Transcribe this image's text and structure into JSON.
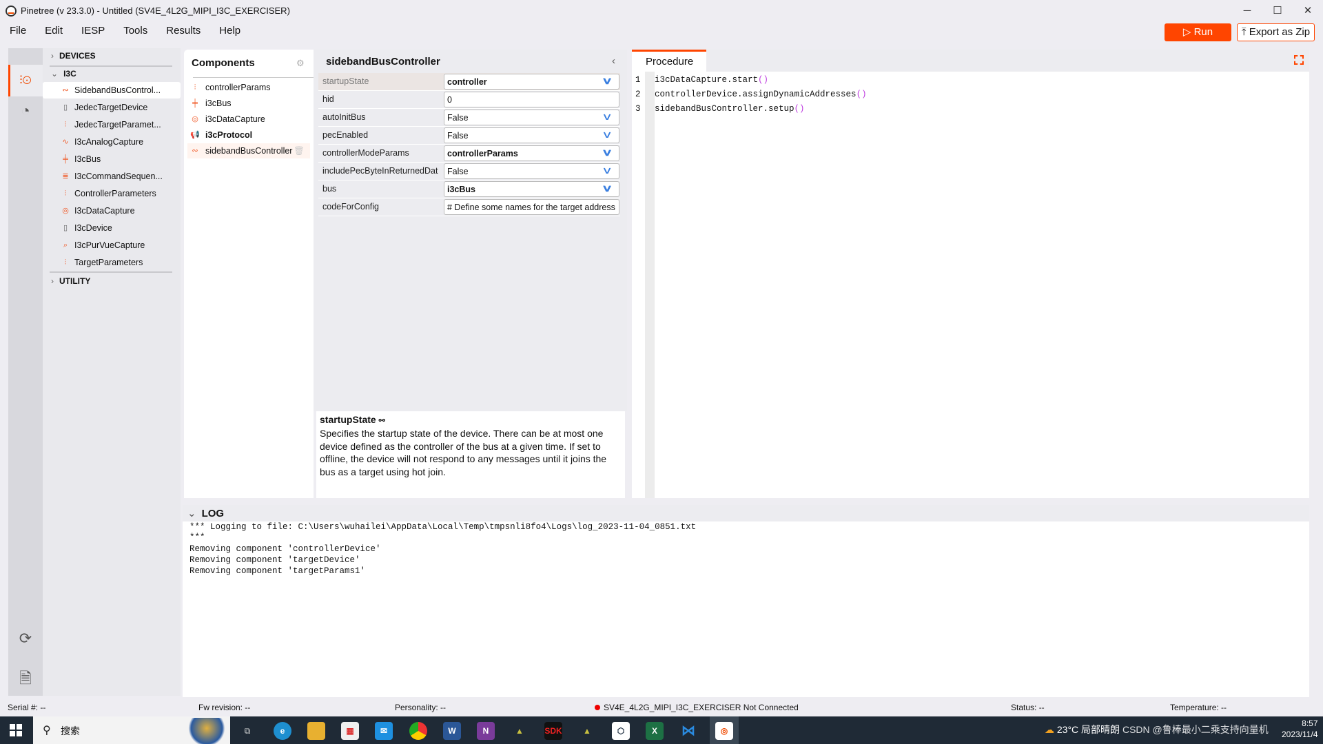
{
  "window": {
    "title": "Pinetree (v 23.3.0) - Untitled (SV4E_4L2G_MIPI_I3C_EXERCISER)",
    "minimize": "─",
    "maximize": "☐",
    "close": "✕"
  },
  "menu": [
    "File",
    "Edit",
    "IESP",
    "Tools",
    "Results",
    "Help"
  ],
  "toolbar": {
    "run_label": "▷ Run",
    "export_label": "⤒ Export as Zip",
    "accent": "#ff4500"
  },
  "tree": {
    "devices": "DEVICES",
    "i3c": "I3C",
    "utility": "UTILITY",
    "items": [
      {
        "label": "SidebandBusControl...",
        "icon": "sideband-icon"
      },
      {
        "label": "JedecTargetDevice",
        "icon": "device-icon"
      },
      {
        "label": "JedecTargetParamet...",
        "icon": "sliders-icon"
      },
      {
        "label": "I3cAnalogCapture",
        "icon": "analog-icon"
      },
      {
        "label": "I3cBus",
        "icon": "bus-icon"
      },
      {
        "label": "I3cCommandSequen...",
        "icon": "sequence-icon"
      },
      {
        "label": "ControllerParameters",
        "icon": "sliders-icon"
      },
      {
        "label": "I3cDataCapture",
        "icon": "capture-icon"
      },
      {
        "label": "I3cDevice",
        "icon": "device-icon"
      },
      {
        "label": "I3cPurVueCapture",
        "icon": "purvue-icon"
      },
      {
        "label": "TargetParameters",
        "icon": "sliders-icon"
      }
    ]
  },
  "components": {
    "title": "Components",
    "items": [
      {
        "label": "controllerParams"
      },
      {
        "label": "i3cBus"
      },
      {
        "label": "i3cDataCapture"
      },
      {
        "label": "i3cProtocol"
      },
      {
        "label": "sidebandBusController"
      }
    ]
  },
  "properties": {
    "title": "sidebandBusController",
    "rows": [
      {
        "label": "startupState",
        "value": "controller"
      },
      {
        "label": "hid",
        "value": "0"
      },
      {
        "label": "autoInitBus",
        "value": "False"
      },
      {
        "label": "pecEnabled",
        "value": "False"
      },
      {
        "label": "controllerModeParams",
        "value": "controllerParams"
      },
      {
        "label": "includePecByteInReturnedDat",
        "value": "False"
      },
      {
        "label": "bus",
        "value": "i3cBus"
      },
      {
        "label": "codeForConfig",
        "value": "# Define some names for the target address"
      }
    ],
    "description_title": "startupState",
    "description": "Specifies the startup state of the device. There can be at most one device defined as the controller of the bus at a given time. If set to offline, the device will not respond to any messages until it joins the bus as a target using hot join."
  },
  "procedure": {
    "tab": "Procedure",
    "lines": [
      {
        "n": "1",
        "code": "i3cDataCapture.start",
        "paren": "()"
      },
      {
        "n": "2",
        "code": "controllerDevice.assignDynamicAddresses",
        "paren": "()"
      },
      {
        "n": "3",
        "code": "sidebandBusController.setup",
        "paren": "()"
      }
    ]
  },
  "log": {
    "title": "LOG",
    "lines": [
      "*** Logging to file: C:\\Users\\wuhailei\\AppData\\Local\\Temp\\tmpsnli8fo4\\Logs\\log_2023-11-04_0851.txt",
      "***",
      "Removing component 'controllerDevice'",
      "Removing component 'targetDevice'",
      "Removing component 'targetParams1'"
    ]
  },
  "status": {
    "serial": "Serial #:   --",
    "fw": "Fw revision: --",
    "personality": "Personality: --",
    "connection": "SV4E_4L2G_MIPI_I3C_EXERCISER  Not Connected",
    "state": "Status: --",
    "temperature": "Temperature: --"
  },
  "taskbar": {
    "search": "搜索",
    "weather": "23°C  局部晴朗",
    "tray": "CSDN @鲁棒最小二乘支持向量机",
    "time": "8:57",
    "date": "2023/11/4"
  }
}
